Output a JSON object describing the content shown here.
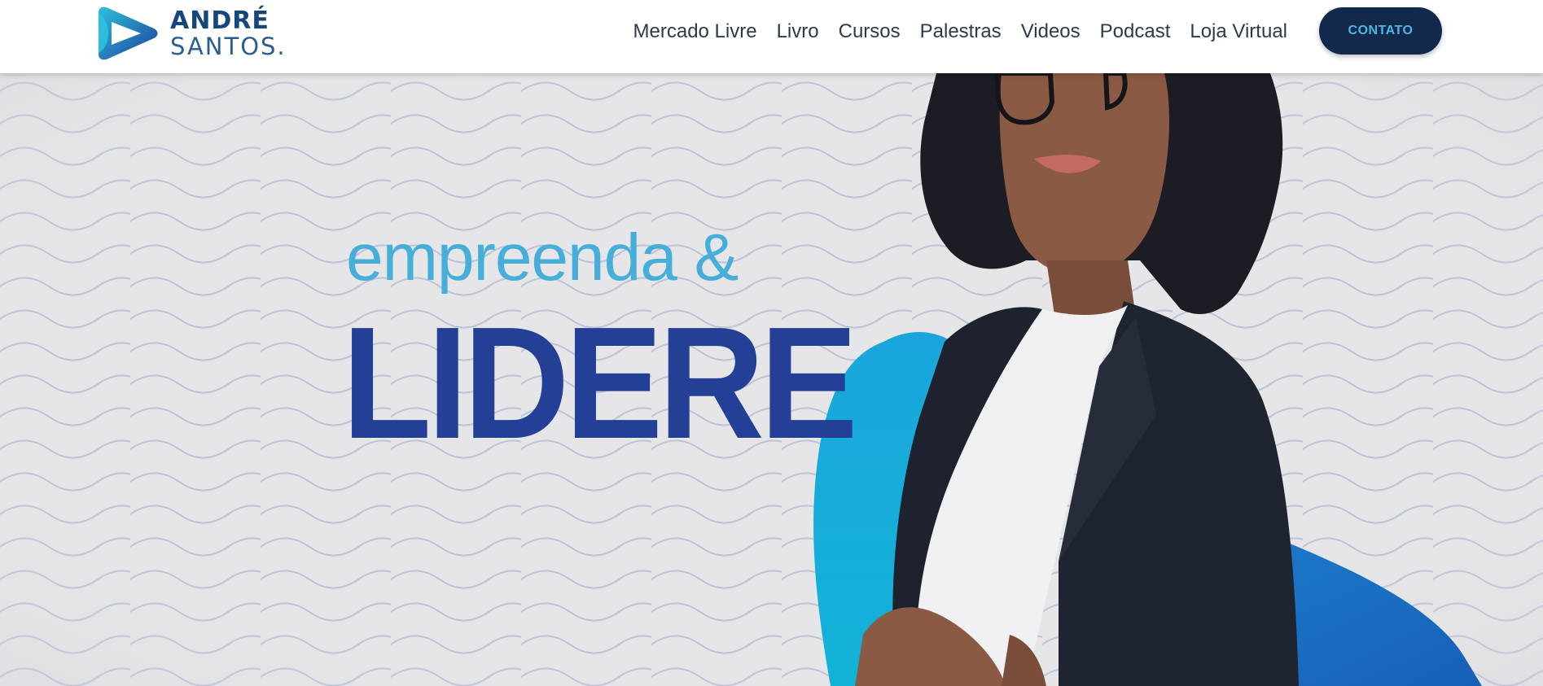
{
  "brand": {
    "name_line1": "ANDRÉ",
    "name_line2": "SANTOS.",
    "logo_icon": "play-triangle-icon",
    "colors": {
      "primary": "#15467c",
      "accent": "#4bb7e4"
    }
  },
  "nav": {
    "items": [
      {
        "label": "Mercado Livre"
      },
      {
        "label": "Livro"
      },
      {
        "label": "Cursos"
      },
      {
        "label": "Palestras"
      },
      {
        "label": "Videos"
      },
      {
        "label": "Podcast"
      },
      {
        "label": "Loja Virtual"
      }
    ],
    "contact_label": "CONTATO"
  },
  "hero": {
    "subtitle": "empreenda &",
    "title": "LIDERE",
    "colors": {
      "subtitle": "#46aed9",
      "title": "#233f96",
      "background": "#e6e6e8",
      "blob": "#1fa8db"
    }
  }
}
